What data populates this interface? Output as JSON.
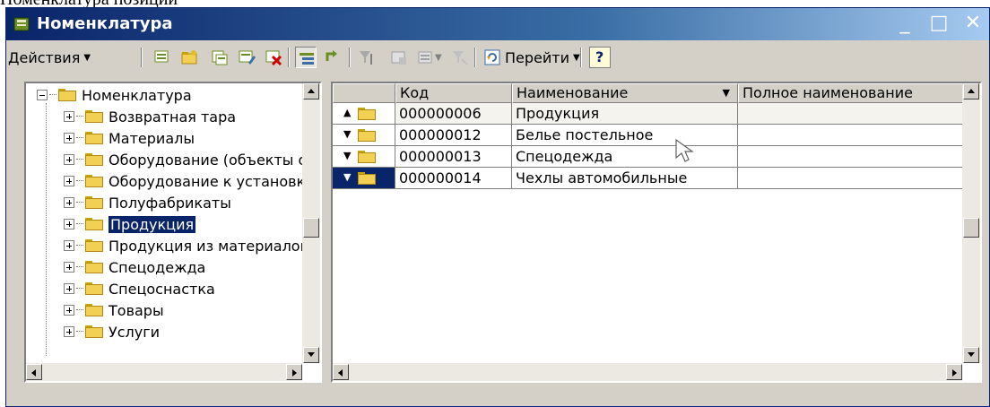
{
  "window": {
    "title": "Номенклатура",
    "title_icon": "catalog-book-icon",
    "buttons": {
      "minimize": "_",
      "maximize": "□",
      "close": "✕"
    }
  },
  "toolbar": {
    "actions_label": "Действия",
    "goto_label": "Перейти",
    "help_label": "?",
    "icons": [
      "add-icon",
      "add-folder-icon",
      "copy-icon",
      "edit-icon",
      "delete-icon",
      "hierarchy-toggle-icon",
      "up-level-icon",
      "filter-icon",
      "filter-clear-icon",
      "filter-list-icon",
      "sort-clear-icon",
      "refresh-icon"
    ]
  },
  "tree": {
    "root": "Номенклатура",
    "items": [
      {
        "label": "Возвратная тара",
        "selected": false
      },
      {
        "label": "Материалы",
        "selected": false
      },
      {
        "label": "Оборудование (объекты основных средств)",
        "selected": false
      },
      {
        "label": "Оборудование к установке",
        "selected": false
      },
      {
        "label": "Полуфабрикаты",
        "selected": false
      },
      {
        "label": "Продукция",
        "selected": true
      },
      {
        "label": "Продукция из материалов заказчика",
        "selected": false
      },
      {
        "label": "Спецодежда",
        "selected": false
      },
      {
        "label": "Спецоснастка",
        "selected": false
      },
      {
        "label": "Товары",
        "selected": false
      },
      {
        "label": "Услуги",
        "selected": false
      }
    ]
  },
  "grid": {
    "columns": [
      "",
      "Код",
      "Наименование",
      "Полное наименование"
    ],
    "rows": [
      {
        "marker": "up",
        "code": "000000006",
        "name": "Продукция",
        "full_name": ""
      },
      {
        "marker": "down",
        "code": "000000012",
        "name": "Белье постельное",
        "full_name": ""
      },
      {
        "marker": "down",
        "code": "000000013",
        "name": "Спецодежда",
        "full_name": ""
      },
      {
        "marker": "down",
        "code": "000000014",
        "name": "Чехлы автомобильные",
        "full_name": ""
      }
    ]
  },
  "colors": {
    "titlebar": "#0a246a",
    "selection": "#0a246a",
    "face": "#d4d0c8",
    "folder": "#f2d054"
  }
}
